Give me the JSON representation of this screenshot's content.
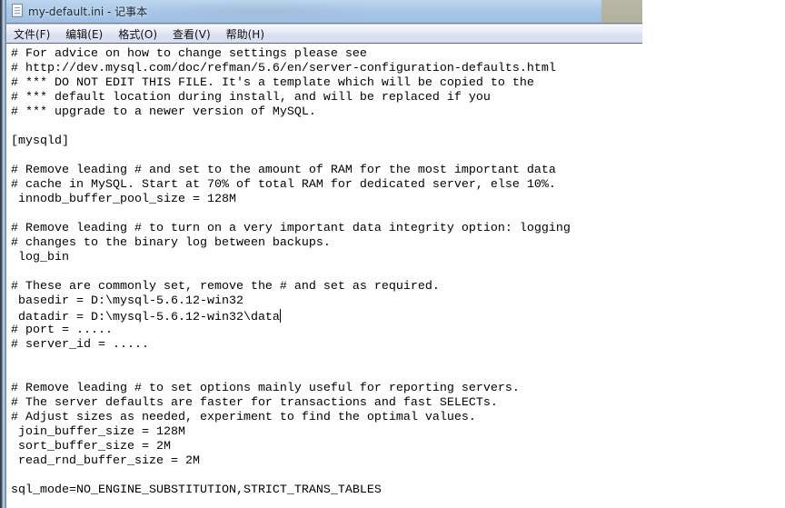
{
  "window": {
    "title": "my-default.ini - 记事本",
    "app_icon": "notepad-icon"
  },
  "menu": {
    "items": [
      {
        "label": "文件(F)"
      },
      {
        "label": "编辑(E)"
      },
      {
        "label": "格式(O)"
      },
      {
        "label": "查看(V)"
      },
      {
        "label": "帮助(H)"
      }
    ]
  },
  "editor": {
    "caret_line": 18,
    "lines": [
      "# For advice on how to change settings please see",
      "# http://dev.mysql.com/doc/refman/5.6/en/server-configuration-defaults.html",
      "# *** DO NOT EDIT THIS FILE. It's a template which will be copied to the",
      "# *** default location during install, and will be replaced if you",
      "# *** upgrade to a newer version of MySQL.",
      "",
      "[mysqld]",
      "",
      "# Remove leading # and set to the amount of RAM for the most important data",
      "# cache in MySQL. Start at 70% of total RAM for dedicated server, else 10%.",
      " innodb_buffer_pool_size = 128M",
      "",
      "# Remove leading # to turn on a very important data integrity option: logging",
      "# changes to the binary log between backups.",
      " log_bin",
      "",
      "# These are commonly set, remove the # and set as required.",
      " basedir = D:\\mysql-5.6.12-win32",
      " datadir = D:\\mysql-5.6.12-win32\\data",
      "# port = .....",
      "# server_id = .....",
      "",
      "",
      "# Remove leading # to set options mainly useful for reporting servers.",
      "# The server defaults are faster for transactions and fast SELECTs.",
      "# Adjust sizes as needed, experiment to find the optimal values.",
      " join_buffer_size = 128M",
      " sort_buffer_size = 2M",
      " read_rnd_buffer_size = 2M",
      "",
      "sql_mode=NO_ENGINE_SUBSTITUTION,STRICT_TRANS_TABLES"
    ]
  }
}
